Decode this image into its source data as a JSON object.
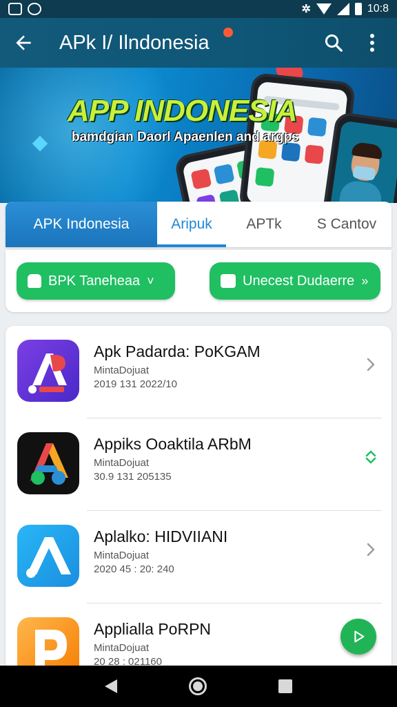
{
  "status_bar": {
    "time": "10:8",
    "bluetooth": "&"
  },
  "app_bar": {
    "title": "APk I/ Ilndonesia",
    "back_icon": "arrow-left-icon",
    "search_icon": "search-icon",
    "more_icon": "more-vert-icon"
  },
  "banner": {
    "title": "APP INDONESIA",
    "subtitle": "bamdgian Daorl Apaenlen and argps"
  },
  "tabs": [
    {
      "label": "APK Indonesia",
      "state": "primary"
    },
    {
      "label": "Aripuk",
      "state": "active"
    },
    {
      "label": "APTk",
      "state": "normal"
    },
    {
      "label": "S Cantov",
      "state": "normal"
    }
  ],
  "filters": {
    "left": {
      "label": "BPK Taneheaa",
      "arrow": "˅"
    },
    "right": {
      "label": "Unecest Dudaerre",
      "arrow": "»"
    }
  },
  "apps": [
    {
      "name": "Apk Padarda: PoKGAM",
      "sub": "MintaDojuat",
      "meta": "2019 131 2022/10",
      "icon_bg": "#5b2fd8",
      "chevron": "chevron-right-icon"
    },
    {
      "name": "Appiks Ooaktila ARbM",
      "sub": "MintaDojuat",
      "meta": "30.9 131 205135",
      "icon_bg": "#111111",
      "chevron": "chevron-updown-icon"
    },
    {
      "name": "Aplalko: HIDVIIANI",
      "sub": "MintaDojuat",
      "meta": "2020 45 : 20: 240",
      "icon_bg": "#1a9ff0",
      "chevron": "chevron-right-icon"
    },
    {
      "name": "Applialla PoRPN",
      "sub": "MintaDojuat",
      "meta": "20 28 : 021160",
      "icon_bg": "#f5a623",
      "chevron": ""
    }
  ],
  "fab": {
    "icon": "play-icon",
    "color": "#21b457"
  },
  "nav": {
    "back": "nav-back-icon",
    "home": "nav-home-icon",
    "recent": "nav-recent-icon"
  },
  "colors": {
    "app_bar": "#135a7a",
    "accent_green": "#1fbf62",
    "tab_primary": "#1b74bc",
    "tab_active": "#1e88d6"
  }
}
